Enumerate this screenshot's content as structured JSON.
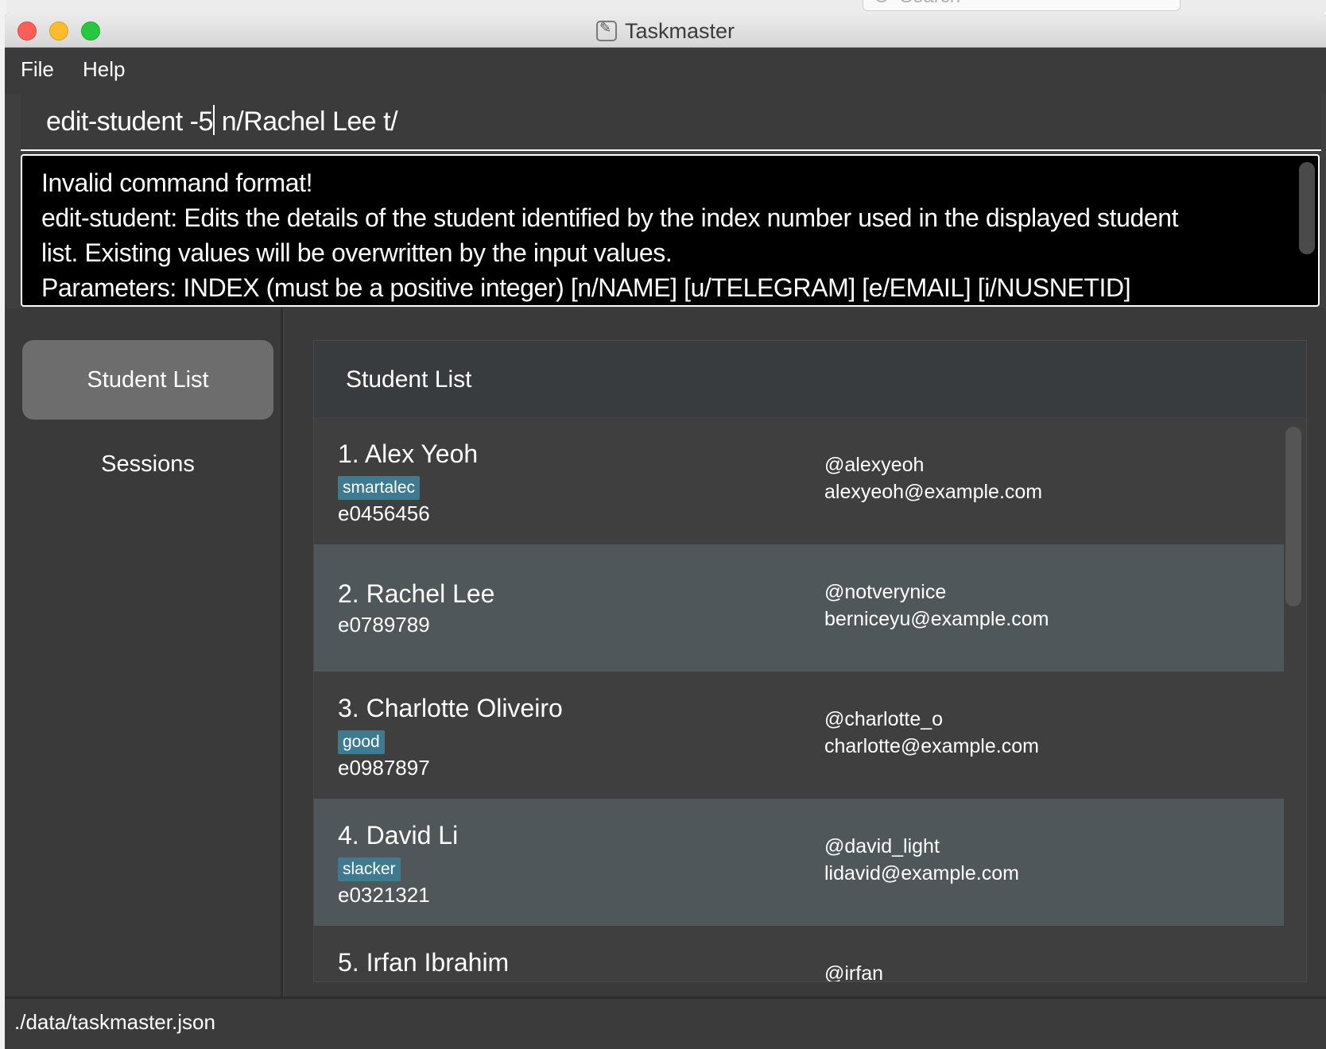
{
  "window": {
    "title": "Taskmaster",
    "app_icon": "taskmaster-app-icon"
  },
  "background": {
    "search_placeholder": "Search"
  },
  "menu": {
    "file": "File",
    "help": "Help"
  },
  "command": {
    "before_caret": "edit-student -5",
    "after_caret": " n/Rachel Lee t/"
  },
  "result": {
    "lines": [
      "Invalid command format!",
      "edit-student: Edits the details of the student identified by the index number used in the displayed student list. Existing values will be overwritten by the input values.",
      "Parameters: INDEX (must be a positive integer) [n/NAME] [u/TELEGRAM] [e/EMAIL] [i/NUSNETID]"
    ]
  },
  "sidebar": {
    "student_list": "Student List",
    "sessions": "Sessions"
  },
  "list": {
    "title": "Student List",
    "students": [
      {
        "name": "1.  Alex Yeoh",
        "tag": "smartalec",
        "nusnetid": "e0456456",
        "telegram": "@alexyeoh",
        "email": "alexyeoh@example.com"
      },
      {
        "name": "2.  Rachel Lee",
        "tag": "",
        "nusnetid": "e0789789",
        "telegram": "@notverynice",
        "email": "berniceyu@example.com"
      },
      {
        "name": "3.  Charlotte Oliveiro",
        "tag": "good",
        "nusnetid": "e0987897",
        "telegram": "@charlotte_o",
        "email": "charlotte@example.com"
      },
      {
        "name": "4.  David Li",
        "tag": "slacker",
        "nusnetid": "e0321321",
        "telegram": "@david_light",
        "email": "lidavid@example.com"
      },
      {
        "name": "5.  Irfan Ibrahim",
        "tag": "",
        "nusnetid": "",
        "telegram": "@irfan",
        "email": ""
      }
    ]
  },
  "status": {
    "file_path": "./data/taskmaster.json"
  },
  "colors": {
    "tag_background": "#3e7b91",
    "selected_nav": "#6d6d6d",
    "alt_row": "#50575a"
  }
}
